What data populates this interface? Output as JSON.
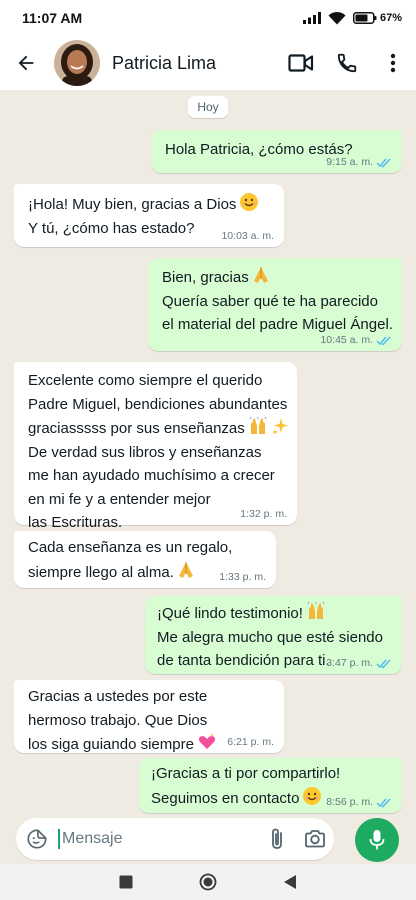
{
  "status_bar": {
    "time": "11:07 AM",
    "battery": "67%"
  },
  "header": {
    "contact_name": "Patricia Lima"
  },
  "chat": {
    "date_chip": "Hoy",
    "messages": [
      {
        "dir": "out",
        "lines": [
          "Hola Patricia, ¿cómo estás?"
        ],
        "time": "9:15 a. m."
      },
      {
        "dir": "in",
        "lines": [
          "¡Hola! Muy bien, gracias a Dios",
          "Y tú, ¿cómo has estado?"
        ],
        "time": "10:03 a. m."
      },
      {
        "dir": "out",
        "lines": [
          "Bien, gracias",
          "Quería saber qué te ha parecido",
          "el material del padre Miguel Ángel."
        ],
        "time": "10:45 a. m."
      },
      {
        "dir": "in",
        "lines": [
          "Excelente como siempre el querido",
          "Padre Miguel, bendiciones abundantes",
          "graciasssss por sus enseñanzas",
          "De verdad sus libros y enseñanzas",
          "me han ayudado muchísimo a crecer",
          "en mi fe y a entender mejor",
          "las Escrituras."
        ],
        "time": "1:32 p. m."
      },
      {
        "dir": "in",
        "lines": [
          "Cada enseñanza es un regalo,",
          "siempre llego al alma."
        ],
        "time": "1:33 p. m."
      },
      {
        "dir": "out",
        "lines": [
          "¡Qué lindo testimonio!",
          "Me alegra mucho que esté siendo",
          "de tanta bendición para ti."
        ],
        "time": "3:47 p. m."
      },
      {
        "dir": "in",
        "lines": [
          "Gracias a ustedes por este",
          "hermoso trabajo. Que Dios",
          "los siga guiando siempre"
        ],
        "time": "6:21 p. m."
      },
      {
        "dir": "out",
        "lines": [
          "¡Gracias a ti por compartirlo!",
          "Seguimos en contacto"
        ],
        "time": "8:56 p. m."
      }
    ]
  },
  "composer": {
    "placeholder": "Mensaje"
  },
  "colors": {
    "outgoing": "#d9fdd3",
    "incoming": "#ffffff",
    "accent": "#1daa61",
    "read_ticks": "#53bdeb"
  },
  "icons": [
    "back-arrow-icon",
    "video-call-icon",
    "phone-icon",
    "more-options-icon",
    "sticker-icon",
    "attach-icon",
    "camera-icon",
    "mic-icon",
    "double-check-icon",
    "smile-emoji",
    "praying-hands-emoji",
    "raising-hands-emoji",
    "sparkles-emoji",
    "sparkling-heart-emoji"
  ]
}
